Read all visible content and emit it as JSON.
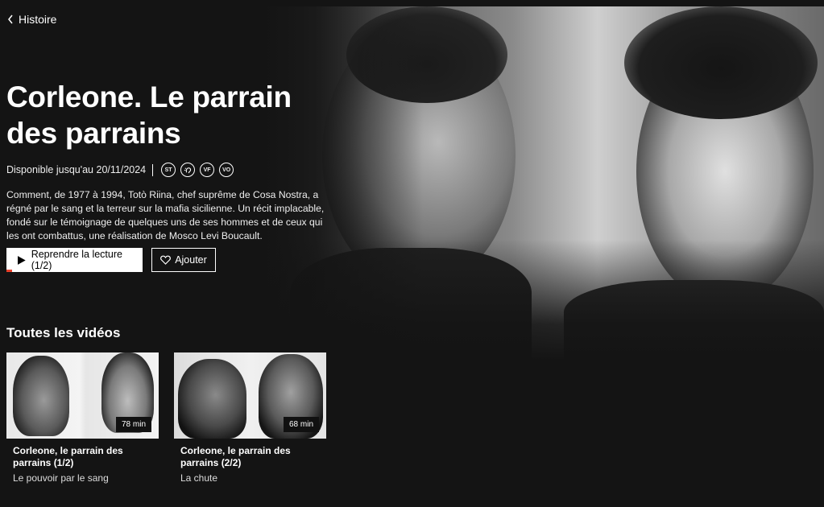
{
  "nav": {
    "back_label": "Histoire"
  },
  "program": {
    "title": "Corleone. Le parrain des parrains",
    "availability": "Disponible jusqu'au 20/11/2024",
    "badges": [
      "ST",
      "AD",
      "VF",
      "VO"
    ],
    "description": "Comment, de 1977 à 1994, Totò Riina, chef suprême de Cosa Nostra, a régné par le sang et la terreur sur la mafia sicilienne. Un récit implacable, fondé sur le témoignage de quelques uns de ses hommes et de ceux qui les ont combattus, une réalisation de Mosco Levi Boucault.",
    "play_label": "Reprendre la lecture (1/2)",
    "add_label": "Ajouter",
    "progress_percent": 4
  },
  "videos": {
    "section_title": "Toutes les vidéos",
    "items": [
      {
        "title": "Corleone, le parrain des parrains (1/2)",
        "subtitle": "Le pouvoir par le sang",
        "duration": "78 min"
      },
      {
        "title": "Corleone, le parrain des parrains (2/2)",
        "subtitle": "La chute",
        "duration": "68 min"
      }
    ]
  },
  "colors": {
    "background": "#141414",
    "accent": "#e8402b"
  }
}
